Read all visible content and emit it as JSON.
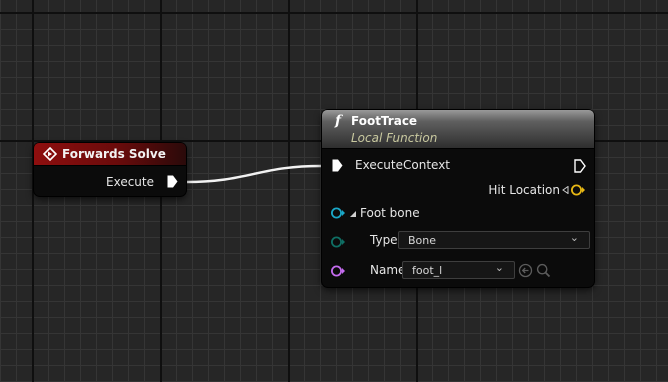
{
  "forwards_solve": {
    "title": "Forwards Solve",
    "execute_label": "Execute",
    "header_color": "#8e0e0e"
  },
  "foot_trace": {
    "function_glyph": "f",
    "title": "FootTrace",
    "subtitle": "Local Function",
    "execute_context_label": "ExecuteContext",
    "hit_location_label": "Hit Location",
    "foot_bone_label": "Foot bone",
    "type_label": "Type",
    "type_value": "Bone",
    "name_label": "Name",
    "name_value": "foot_l",
    "icons": [
      "function-icon",
      "exec-in-pin-icon",
      "exec-out-pin-icon",
      "vector-pin-icon",
      "struct-pin-icon",
      "enum-pin-icon",
      "name-pin-icon",
      "expand-arrow-icon",
      "chevron-down-icon",
      "use-selected-icon",
      "browse-icon"
    ]
  },
  "colors": {
    "vector_pin": "#e8b814",
    "struct_pin": "#1aa8c8",
    "enum_pin": "#0f6f64",
    "name_pin": "#c56cf0",
    "wire": "#ffffff"
  }
}
